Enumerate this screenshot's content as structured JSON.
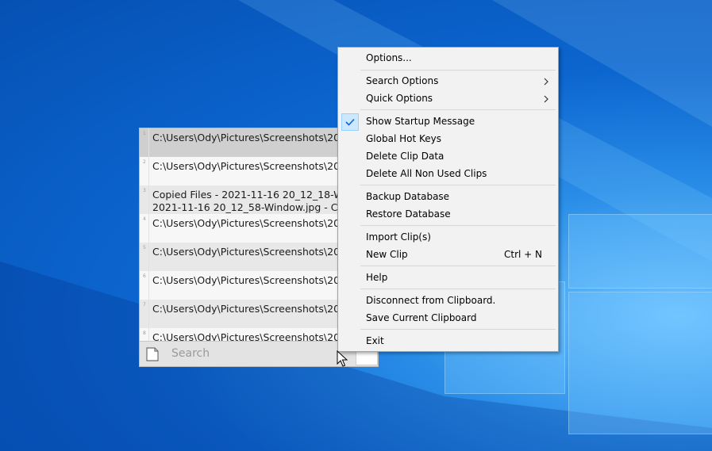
{
  "desktop": {
    "colors": {
      "wallpaper": "#0c66cf",
      "logo_pane": "#78c8ff"
    }
  },
  "clip_window": {
    "rows": [
      {
        "num": "1",
        "text": "C:\\Users\\Ody\\Pictures\\Screenshots\\2021",
        "selected": true
      },
      {
        "num": "2",
        "text": "C:\\Users\\Ody\\Pictures\\Screenshots\\2021"
      },
      {
        "num": "3",
        "text": "Copied Files - 2021-11-16 20_12_18-Wox\n2021-11-16 20_12_58-Window.jpg - C:\\U"
      },
      {
        "num": "4",
        "text": "C:\\Users\\Ody\\Pictures\\Screenshots\\2021"
      },
      {
        "num": "5",
        "text": "C:\\Users\\Ody\\Pictures\\Screenshots\\2021"
      },
      {
        "num": "6",
        "text": "C:\\Users\\Ody\\Pictures\\Screenshots\\2021"
      },
      {
        "num": "7",
        "text": "C:\\Users\\Ody\\Pictures\\Screenshots\\2021"
      },
      {
        "num": "8",
        "text": "C:\\Users\\Ody\\Pictures\\Screenshots\\2021"
      }
    ],
    "search": {
      "placeholder": "Search",
      "icon": "document-icon"
    }
  },
  "context_menu": {
    "items": [
      {
        "label": "Options..."
      },
      {
        "label": "Search Options",
        "submenu": true
      },
      {
        "label": "Quick Options",
        "submenu": true
      },
      {
        "label": "Show Startup Message",
        "checked": true
      },
      {
        "label": "Global Hot Keys"
      },
      {
        "label": "Delete Clip Data"
      },
      {
        "label": "Delete All Non Used Clips"
      },
      {
        "label": "Backup Database"
      },
      {
        "label": "Restore Database"
      },
      {
        "label": "Import Clip(s)"
      },
      {
        "label": "New Clip",
        "shortcut": "Ctrl + N"
      },
      {
        "label": "Help"
      },
      {
        "label": "Disconnect from Clipboard."
      },
      {
        "label": "Save Current Clipboard"
      },
      {
        "label": "Exit"
      }
    ],
    "colors": {
      "check_highlight": "#cce8ff",
      "check_mark": "#0a64d8"
    }
  }
}
